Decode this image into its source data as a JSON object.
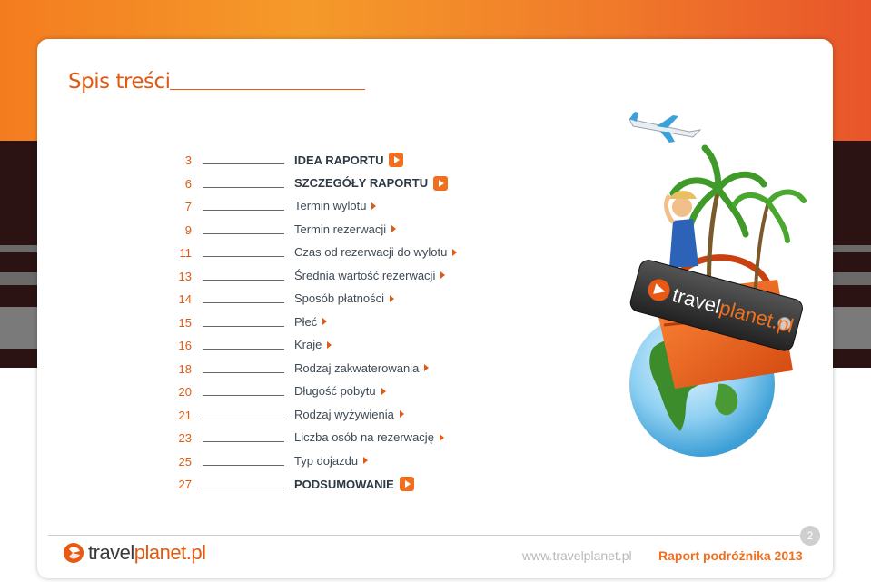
{
  "page": {
    "title": "Spis treści"
  },
  "toc": [
    {
      "page": "3",
      "label": "IDEA RAPORTU",
      "bold": true
    },
    {
      "page": "6",
      "label": "SZCZEGÓŁY RAPORTU",
      "bold": true
    },
    {
      "page": "7",
      "label": "Termin wylotu",
      "bold": false
    },
    {
      "page": "9",
      "label": "Termin rezerwacji",
      "bold": false
    },
    {
      "page": "11",
      "label": "Czas od rezerwacji do wylotu",
      "bold": false
    },
    {
      "page": "13",
      "label": "Średnia wartość rezerwacji",
      "bold": false
    },
    {
      "page": "14",
      "label": "Sposób płatności",
      "bold": false
    },
    {
      "page": "15",
      "label": "Płeć",
      "bold": false
    },
    {
      "page": "16",
      "label": "Kraje",
      "bold": false
    },
    {
      "page": "18",
      "label": "Rodzaj zakwaterowania",
      "bold": false
    },
    {
      "page": "20",
      "label": "Długość pobytu",
      "bold": false
    },
    {
      "page": "21",
      "label": "Rodzaj wyżywienia",
      "bold": false
    },
    {
      "page": "23",
      "label": "Liczba osób na rezerwację",
      "bold": false
    },
    {
      "page": "25",
      "label": "Typ dojazdu",
      "bold": false
    },
    {
      "page": "27",
      "label": "PODSUMOWANIE",
      "bold": true
    }
  ],
  "illustration": {
    "tag_text_main": "travel",
    "tag_text_accent": "planet.pl"
  },
  "footer": {
    "logo_main": "travel",
    "logo_accent": "planet.pl",
    "url": "www.travelplanet.pl",
    "report": "Raport podróżnika 2013",
    "page_number": "2"
  },
  "colors": {
    "accent": "#e05a12",
    "orange": "#f07020",
    "text": "#3f4a55"
  },
  "icons": {
    "toc_arrow": "play-arrow-icon",
    "logo": "travelplanet-logo-icon"
  }
}
